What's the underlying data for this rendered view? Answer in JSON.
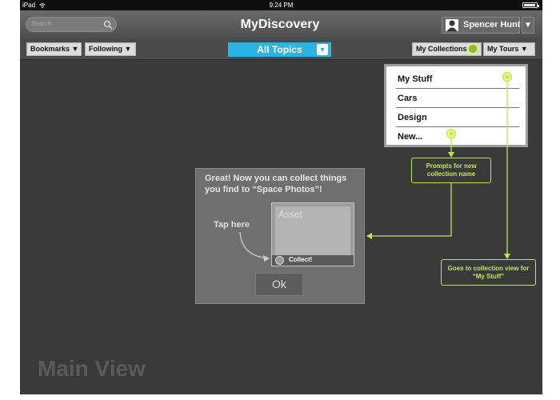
{
  "status_bar": {
    "carrier": "iPad",
    "time": "9:24 PM"
  },
  "header": {
    "title": "MyDiscovery",
    "search_placeholder": "Search",
    "user_name": "Spencer Hunt"
  },
  "toolbar": {
    "bookmarks": "Bookmarks",
    "following": "Following",
    "topics": "All Topics",
    "collections": "My Collections",
    "tours": "My Tours",
    "caret": "▼"
  },
  "dropdown": {
    "items": [
      "My Stuff",
      "Cars",
      "Design",
      "New..."
    ]
  },
  "annotations": {
    "new_collection": "Prompts for new collection name",
    "my_stuff": "Goes to collection view for “My Stuff”"
  },
  "tooltip": {
    "message": "Great! Now you can collect things you find to “Space Photos”!",
    "tap_hint": "Tap here",
    "asset_label": "Asset",
    "collect_label": "Collect!",
    "ok": "Ok"
  },
  "main_view": "Main View",
  "colors": {
    "accent_blue": "#29b5e8",
    "annotation_green": "#bfe84a",
    "background": "#3a3a3a"
  }
}
